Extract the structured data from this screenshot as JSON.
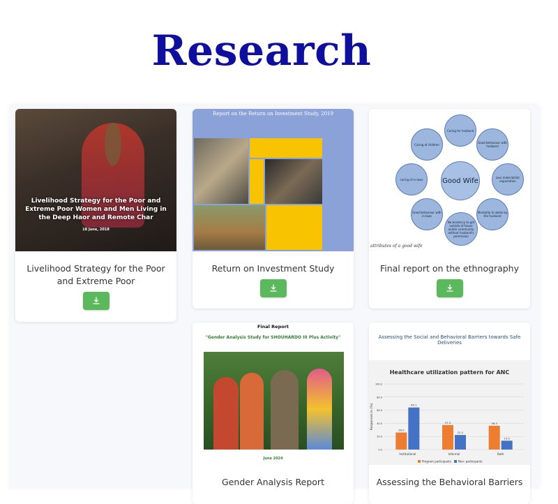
{
  "page": {
    "title": "Research"
  },
  "cards": [
    {
      "title": "Livelihood Strategy for the Poor and Extreme Poor",
      "thumb_text": "Livelihood Strategy for the Poor and\nExtreme Poor Women and Men Living in\nthe Deep Haor and Remote Char",
      "thumb_date": "18 June, 2018",
      "download_icon": "download-icon"
    },
    {
      "title": "Return on Investment Study",
      "thumb_header": "Report on the Return on Investment Study, 2019",
      "download_icon": "download-icon"
    },
    {
      "title": "Final report on the ethnography",
      "thumb_center": "Good Wife",
      "thumb_bubbles": [
        "Caring for husband",
        "Good behaviour with husband",
        "Less materialistic expectation",
        "Mentality to abide by the husband",
        "No tendency to get outside of house and/or community without husband's permission",
        "Good behaviour with in-laws",
        "caring of in-laws",
        "Caring of children"
      ],
      "thumb_caption": "attributes of a good wife",
      "download_icon": "download-icon"
    },
    {
      "title": "Gender Analysis Report",
      "thumb_final": "Final Report",
      "thumb_subtitle": "\"Gender Analysis Study for SHOUHARDO III Plus Activity\"",
      "thumb_date": "June 2024"
    },
    {
      "title": "Assessing the Behavioral Barriers",
      "thumb_header": "Assessing the Social and Behavioral Barriers towards Safe Deliveries"
    }
  ],
  "chart_data": {
    "type": "bar",
    "title": "Healthcare utilization pattern for ANC",
    "ylabel": "Responses in (%)",
    "categories": [
      "Institutional",
      "Informal",
      "Both"
    ],
    "ylim": [
      0,
      100
    ],
    "yticks": [
      "0.0",
      "20.0",
      "40.0",
      "60.0",
      "80.0",
      "100.0"
    ],
    "series": [
      {
        "name": "Program participants",
        "values": [
          26.0,
          37.3,
          36.3
        ],
        "labels": [
          "26.0",
          "37.3",
          "36.3"
        ],
        "color": "#ed7d31"
      },
      {
        "name": "Non- participants",
        "values": [
          64.1,
          22.2,
          13.5
        ],
        "labels": [
          "64.1",
          "22.2",
          "13.5"
        ],
        "color": "#4472c4"
      }
    ],
    "legend": "bottom"
  },
  "colors": {
    "title": "#0f0f9e",
    "button": "#5cb85c"
  }
}
